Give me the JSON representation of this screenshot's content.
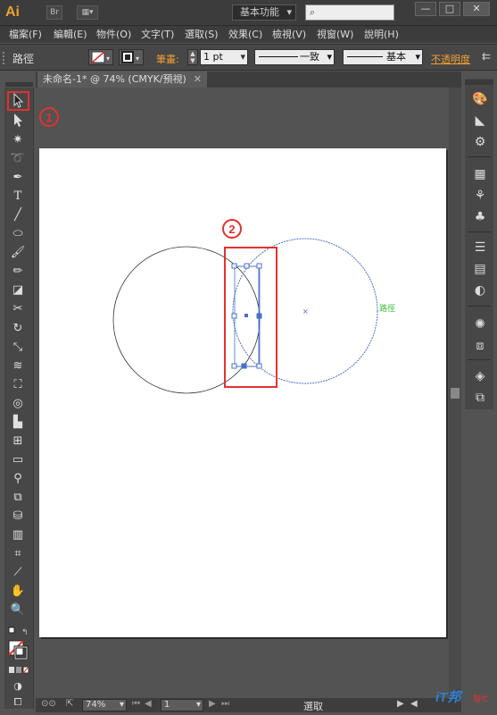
{
  "app": {
    "logo": "Ai",
    "workspace": "基本功能",
    "br_label": "Br",
    "doc_tab": "未命名-1* @ 74% (CMYK/預視)"
  },
  "window_buttons": [
    "—",
    "□",
    "✕"
  ],
  "menus": [
    "檔案(F)",
    "編輯(E)",
    "物件(O)",
    "文字(T)",
    "選取(S)",
    "效果(C)",
    "檢視(V)",
    "視窗(W)",
    "說明(H)"
  ],
  "control": {
    "selection_label": "路徑",
    "stroke_label": "筆畫:",
    "stroke_value": "1 pt",
    "profile_label": "一致",
    "brush_label": "基本",
    "opacity_label": "不透明度"
  },
  "canvas": {
    "path_hint": "路徑",
    "annotation_1": "1",
    "annotation_2": "2"
  },
  "status": {
    "zoom": "74%",
    "page": "1",
    "tool_name": "選取"
  },
  "watermark": {
    "brand": "iT邦",
    "sub": "幫忙"
  },
  "colors": {
    "highlight": "#e53030",
    "selection_blue": "#4a6fc8",
    "logo_orange": "#f0a030",
    "hint_green": "#3cbf3c"
  }
}
